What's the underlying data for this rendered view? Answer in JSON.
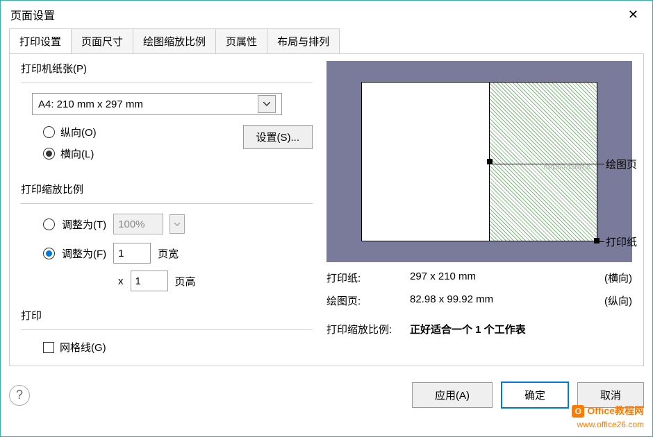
{
  "title": "页面设置",
  "tabs": [
    "打印设置",
    "页面尺寸",
    "绘图缩放比例",
    "页属性",
    "布局与排列"
  ],
  "active_tab": 0,
  "printer_paper": {
    "title": "打印机纸张(P)",
    "selected": "A4:  210 mm x 297 mm",
    "portrait_label": "纵向(O)",
    "landscape_label": "横向(L)",
    "setup_btn": "设置(S)..."
  },
  "print_zoom": {
    "title": "打印缩放比例",
    "adjust_to_label": "调整为(T)",
    "adjust_to_value": "100%",
    "fit_to_label": "调整为(F)",
    "fit_width_value": "1",
    "fit_width_label": "页宽",
    "fit_height_prefix": "x",
    "fit_height_value": "1",
    "fit_height_label": "页高"
  },
  "print": {
    "title": "打印",
    "gridlines_label": "网格线(G)"
  },
  "preview": {
    "callout_drawing": "绘图页",
    "callout_paper": "打印纸",
    "info_paper_label": "打印纸:",
    "info_paper_value": "297 x 210 mm",
    "info_paper_orient": "(横向)",
    "info_drawing_label": "绘图页:",
    "info_drawing_value": "82.98 x 99.92 mm",
    "info_drawing_orient": "(纵向)",
    "zoom_label": "打印缩放比例:",
    "zoom_value": "正好适合一个 1 个工作表",
    "faint": "https://blog.c"
  },
  "buttons": {
    "apply": "应用(A)",
    "ok": "确定",
    "cancel": "取消"
  },
  "watermark": {
    "line1": "Office教程网",
    "line2": "www.office26.com"
  }
}
